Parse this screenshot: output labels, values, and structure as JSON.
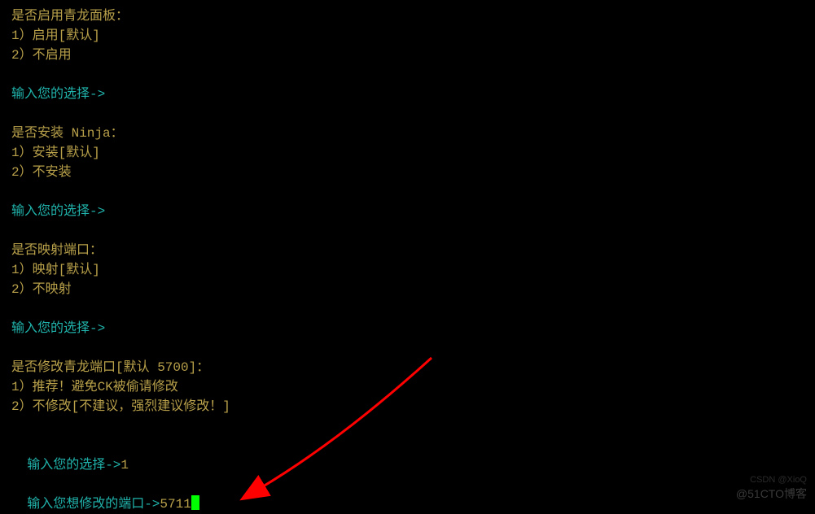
{
  "sections": {
    "qinglong": {
      "title": "是否启用青龙面板：",
      "option1": "1）启用[默认]",
      "option2": "2）不启用",
      "prompt": "输入您的选择->"
    },
    "ninja": {
      "title": "是否安装 Ninja：",
      "option1": "1）安装[默认]",
      "option2": "2）不安装",
      "prompt": "输入您的选择->"
    },
    "portmap": {
      "title": "是否映射端口：",
      "option1": "1）映射[默认]",
      "option2": "2）不映射",
      "prompt": "输入您的选择->"
    },
    "portchange": {
      "title": "是否修改青龙端口[默认 5700]：",
      "option1": "1）推荐！避免CK被偷请修改",
      "option2": "2）不修改[不建议，强烈建议修改！]",
      "prompt": "输入您的选择->",
      "choice": "1"
    },
    "portinput": {
      "prompt": "输入您想修改的端口->",
      "value": "5711"
    }
  },
  "watermark": {
    "main": "@51CTO博客",
    "sub": "CSDN @XioQ"
  }
}
